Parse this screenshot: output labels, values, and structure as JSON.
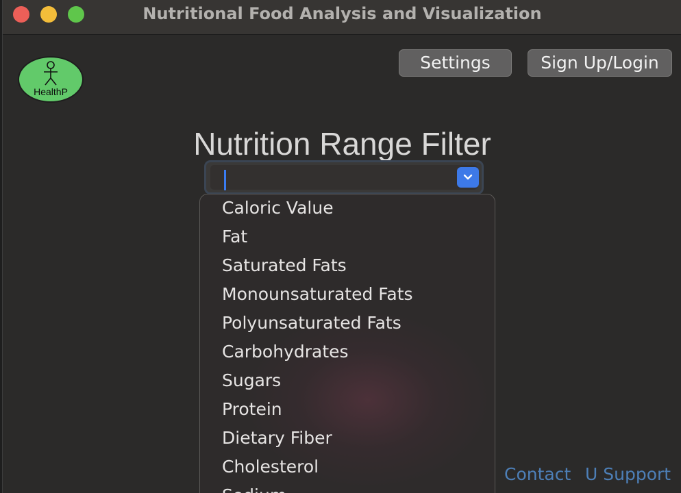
{
  "window": {
    "title": "Nutritional Food Analysis and Visualization"
  },
  "logo": {
    "text": "HealthP"
  },
  "toolbar": {
    "settings_label": "Settings",
    "login_label": "Sign Up/Login"
  },
  "main": {
    "heading": "Nutrition Range Filter"
  },
  "filter": {
    "current_value": "",
    "options": [
      "Caloric Value",
      "Fat",
      "Saturated Fats",
      "Monounsaturated Fats",
      "Polyunsaturated Fats",
      "Carbohydrates",
      "Sugars",
      "Protein",
      "Dietary Fiber",
      "Cholesterol",
      "Sodium"
    ]
  },
  "footer": {
    "contact_label": "Contact",
    "support_label": "U Support"
  },
  "colors": {
    "window_bg": "#2b2a29",
    "accent": "#3d79e8",
    "logo_green": "#62ca6a",
    "link": "#4d7fb7"
  },
  "icons": [
    "close-button",
    "minimize-button",
    "maximize-button",
    "stick-figure-icon",
    "chevron-down-icon"
  ]
}
